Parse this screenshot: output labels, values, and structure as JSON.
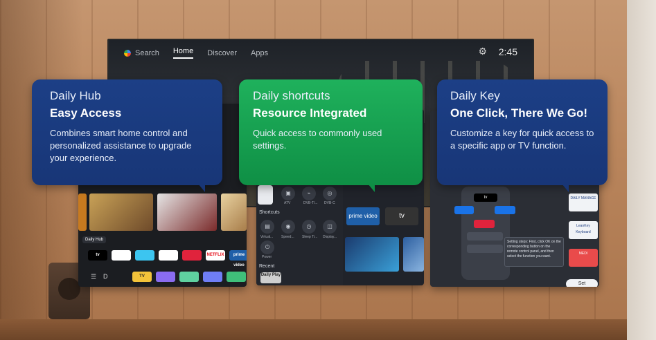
{
  "tv": {
    "nav": [
      "Search",
      "Home",
      "Discover",
      "Apps"
    ],
    "clock": "2:45"
  },
  "callouts": [
    {
      "subtitle": "Daily Hub",
      "title": "Easy Access",
      "description": "Combines smart home control and personalized assistance to upgrade your experience."
    },
    {
      "subtitle": "Daily shortcuts",
      "title": "Resource Integrated",
      "description": "Quick access to commonly used settings."
    },
    {
      "subtitle": "Daily Key",
      "title": "One Click, There We Go!",
      "description": "Customize a key for quick access to a specific app or TV function."
    }
  ],
  "hub_screen": {
    "row_label": "Prime Video",
    "hub_label": "Daily Hub",
    "apps_row1": [
      "tv",
      "",
      "",
      "",
      "",
      "NETFLIX",
      "prime video"
    ],
    "apps_row2": [
      "TV",
      "",
      "",
      "",
      ""
    ]
  },
  "shortcuts_screen": {
    "tabs": [
      "ATV",
      "DVB-T/...",
      "DVB-C"
    ],
    "section_shortcuts": "Shortcuts",
    "shortcuts": [
      "Virtual...",
      "Speed...",
      "Sleep Ti...",
      "Display..."
    ],
    "power": "Power",
    "section_recent": "Recent",
    "recent_app": "Daily Play",
    "prime_tile": "prime video",
    "atv_tile": "tv"
  },
  "key_screen": {
    "remote_top": "tv",
    "steps_text": "Setting steps: First, click OK on the corresponding button on the remote control panel, and then select the function you want.",
    "right_apps": [
      "DAILY MANAGE",
      "LeanKey Keyboard",
      "MEDI"
    ],
    "set_button": "Set"
  },
  "colors": {
    "hub_blue": "#1c3f86",
    "shortcut_green": "#1fb15c"
  }
}
